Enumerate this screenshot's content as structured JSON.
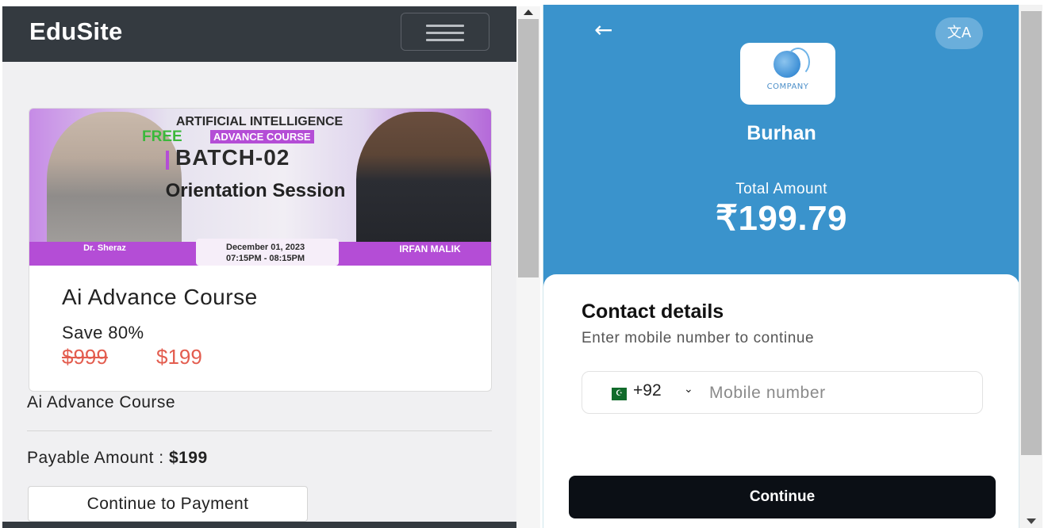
{
  "left": {
    "brand": "EduSite",
    "banner": {
      "line1": "ARTIFICIAL INTELLIGENCE",
      "free": "FREE",
      "advance": "ADVANCE COURSE",
      "batch": "BATCH-02",
      "orientation": "Orientation Session",
      "date": "December 01, 2023",
      "time": "07:15PM - 08:15PM",
      "speaker_left": "Dr. Sheraz",
      "speaker_right": "IRFAN MALIK"
    },
    "card": {
      "title": "Ai Advance Course",
      "save": "Save 80%",
      "old_price": "$999",
      "new_price": "$199"
    },
    "course_name": "Ai Advance Course",
    "payable_label": "Payable Amount :",
    "payable_value": "$199",
    "pay_button": "Continue to Payment"
  },
  "right": {
    "back_icon": "←",
    "translate_icon": "文A",
    "logo_text": "COMPANY",
    "merchant": "Burhan",
    "total_label": "Total Amount",
    "total_amount": "₹199.79",
    "contact_title": "Contact details",
    "contact_subtitle": "Enter mobile number to continue",
    "country_code": "+92",
    "phone_placeholder": "Mobile number",
    "continue_button": "Continue"
  },
  "colors": {
    "navbar": "#343a40",
    "price": "#e35d4f",
    "header_blue": "#3a93cc",
    "button_dark": "#0b0f15"
  }
}
